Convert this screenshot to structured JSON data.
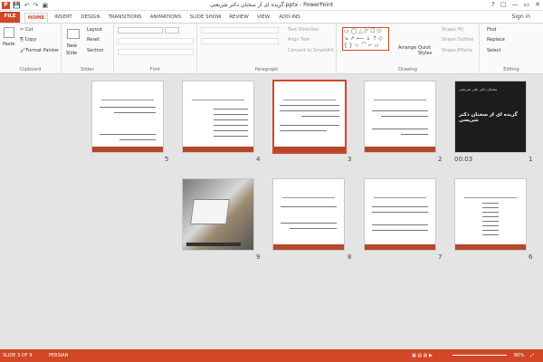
{
  "window": {
    "app_letter": "P",
    "title": "گزیده ای از سخنان دکتر شریعتی.pptx - PowerPoint",
    "quick_access": [
      "💾",
      "↶",
      "↷",
      "▣"
    ],
    "controls": [
      "?",
      "▢",
      "—",
      "▭",
      "✕"
    ]
  },
  "ribbon_tabs": [
    "FILE",
    "HOME",
    "INSERT",
    "DESIGN",
    "TRANSITIONS",
    "ANIMATIONS",
    "SLIDE SHOW",
    "REVIEW",
    "VIEW",
    "ADD-INS"
  ],
  "account": {
    "sign_in": "Sign in"
  },
  "ribbon": {
    "clipboard": {
      "paste": "Paste",
      "cut": "Cut",
      "copy": "Copy",
      "format_painter": "Format Painter",
      "label": "Clipboard"
    },
    "slides": {
      "new_slide": "New",
      "new_slide_2": "Slide",
      "layout": "Layout",
      "reset": "Reset",
      "section": "Section",
      "label": "Slides"
    },
    "font": {
      "label": "Font"
    },
    "paragraph": {
      "text_direction": "Text Direction",
      "align_text": "Align Text",
      "convert": "Convert to SmartArt",
      "label": "Paragraph"
    },
    "drawing": {
      "shapes_row1": "▭ ◯ △ ◸ ☐ ⬭",
      "shapes_row2": "↘ ↗ ⟵ ↓ ↑ ◇",
      "shapes_row3": "{ } ☆ ⌒ ⌐ ▱",
      "arrange": "Arrange",
      "quick_styles": "Quick Styles",
      "shape_fill": "Shape Fill",
      "shape_outline": "Shape Outline",
      "shape_effects": "Shape Effects",
      "label": "Drawing"
    },
    "editing": {
      "find": "Find",
      "replace": "Replace",
      "select": "Select",
      "label": "Editing"
    }
  },
  "slides": [
    {
      "num": "1",
      "title": "سخنان دکتر علی شریعتی",
      "main": "گزیده ای از سخنان دکتر شریعتی",
      "time": "00:03"
    },
    {
      "num": "2"
    },
    {
      "num": "3"
    },
    {
      "num": "4"
    },
    {
      "num": "5"
    },
    {
      "num": "6"
    },
    {
      "num": "7"
    },
    {
      "num": "8"
    },
    {
      "num": "9"
    }
  ],
  "status": {
    "slide_info": "SLIDE 3 OF 9",
    "language": "PERSIAN",
    "zoom": "80%"
  },
  "colors": {
    "accent": "#d24726",
    "slide_bar": "#b7472a"
  }
}
